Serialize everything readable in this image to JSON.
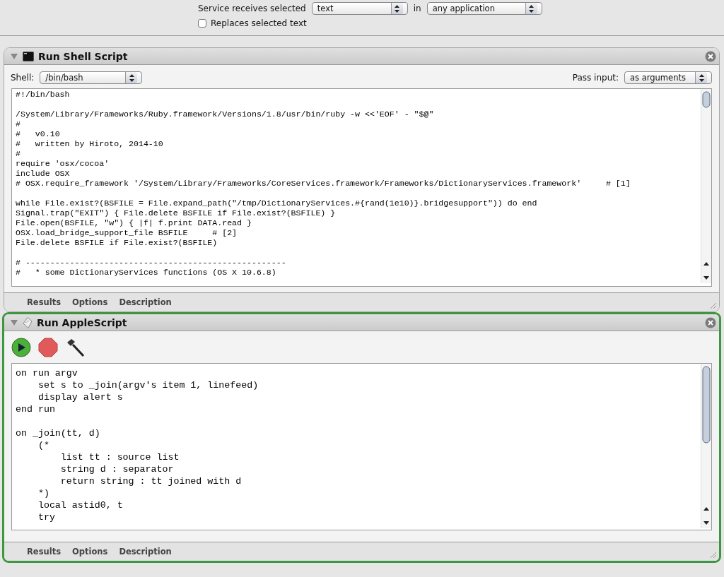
{
  "service_bar": {
    "label": "Service receives selected",
    "input_type": "text",
    "in_label": "in",
    "application": "any application",
    "replaces": {
      "label": "Replaces selected text",
      "checked": false
    }
  },
  "actions": [
    {
      "kind": "shell",
      "title": "Run Shell Script",
      "selected": false,
      "expanded": true,
      "shell_label": "Shell:",
      "shell": "/bin/bash",
      "pass_label": "Pass input:",
      "pass_input": "as arguments",
      "code": "#!/bin/bash\n\n/System/Library/Frameworks/Ruby.framework/Versions/1.8/usr/bin/ruby -w <<'EOF' - \"$@\"\n#\n#   v0.10\n#   written by Hiroto, 2014-10\n#\nrequire 'osx/cocoa'\ninclude OSX\n# OSX.require_framework '/System/Library/Frameworks/CoreServices.framework/Frameworks/DictionaryServices.framework'     # [1]\n\nwhile File.exist?(BSFILE = File.expand_path(\"/tmp/DictionaryServices.#{rand(1e10)}.bridgesupport\")) do end\nSignal.trap(\"EXIT\") { File.delete BSFILE if File.exist?(BSFILE) }\nFile.open(BSFILE, \"w\") { |f| f.print DATA.read }\nOSX.load_bridge_support_file BSFILE     # [2]\nFile.delete BSFILE if File.exist?(BSFILE)\n\n# -----------------------------------------------------\n#   * some DictionaryServices functions (OS X 10.6.8)",
      "footer": [
        "Results",
        "Options",
        "Description"
      ]
    },
    {
      "kind": "applescript",
      "title": "Run AppleScript",
      "selected": true,
      "expanded": true,
      "code": "on run argv\n    set s to _join(argv's item 1, linefeed)\n    display alert s\nend run\n\non _join(tt, d)\n    (*\n        list tt : source list\n        string d : separator\n        return string : tt joined with d\n    *)\n    local astid0, t\n    try",
      "footer": [
        "Results",
        "Options",
        "Description"
      ]
    }
  ]
}
